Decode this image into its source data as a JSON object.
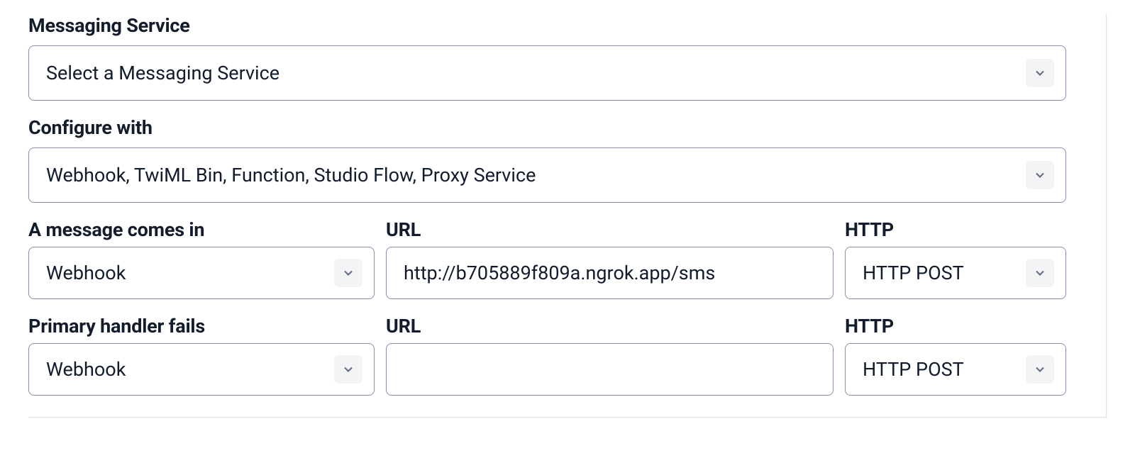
{
  "messaging_service": {
    "label": "Messaging Service",
    "selected": "Select a Messaging Service"
  },
  "configure_with": {
    "label": "Configure with",
    "selected": "Webhook, TwiML Bin, Function, Studio Flow, Proxy Service"
  },
  "message_in": {
    "handler_label": "A message comes in",
    "handler_value": "Webhook",
    "url_label": "URL",
    "url_value": "http://b705889f809a.ngrok.app/sms",
    "http_label": "HTTP",
    "http_value": "HTTP POST"
  },
  "primary_fail": {
    "handler_label": "Primary handler fails",
    "handler_value": "Webhook",
    "url_label": "URL",
    "url_value": "",
    "http_label": "HTTP",
    "http_value": "HTTP POST"
  }
}
